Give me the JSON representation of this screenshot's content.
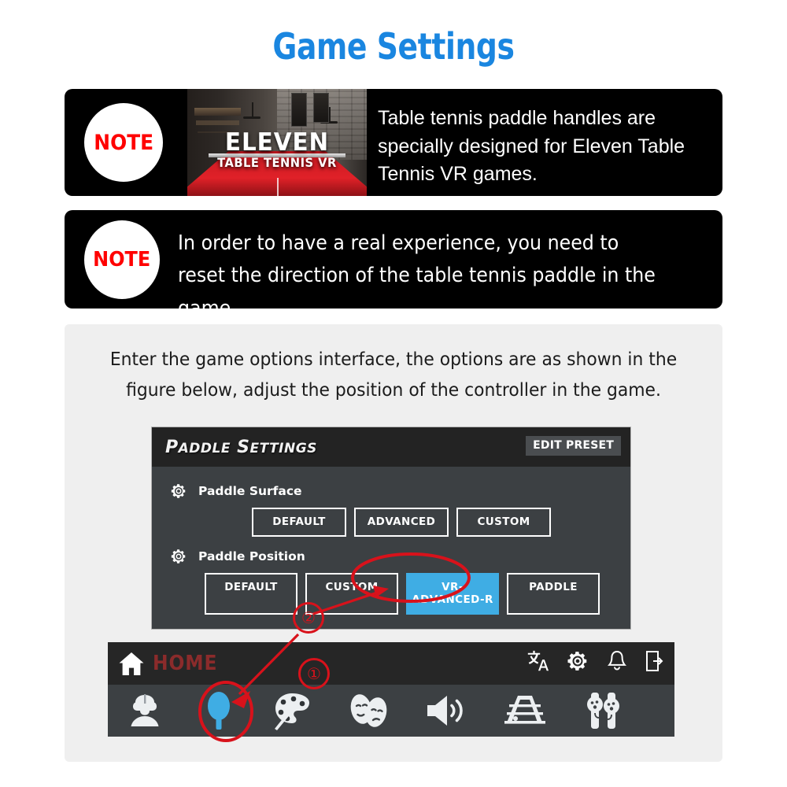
{
  "page": {
    "title": "Game Settings",
    "title_color": "#1a86e0",
    "background": "#ffffff"
  },
  "notes": [
    {
      "badge": "NOTE",
      "badge_color": "#ff0000",
      "text": "Table tennis paddle handles are specially designed for Eleven Table Tennis VR games.",
      "thumbnail": {
        "logo_line1": "ELEVEN",
        "logo_line2": "TABLE TENNIS VR",
        "alt": "eleven-table-tennis-vr-game-screenshot"
      }
    },
    {
      "badge": "NOTE",
      "badge_color": "#ff0000",
      "text": "In order to have a real experience, you need to reset the direction of the table tennis paddle in the game."
    }
  ],
  "instruction": {
    "text": "Enter the game options interface, the options are as shown in the figure below, adjust the position of the controller in the game."
  },
  "settings_panel": {
    "title_first": "P",
    "title_first_rest": "ADDLE",
    "title_second": "S",
    "title_second_rest": "ETTINGS",
    "edit_preset_label": "EDIT PRESET",
    "groups": [
      {
        "icon": "gear-icon",
        "label": "Paddle Surface",
        "options": [
          {
            "label": "DEFAULT",
            "selected": false
          },
          {
            "label": "ADVANCED",
            "selected": false
          },
          {
            "label": "CUSTOM",
            "selected": false
          }
        ]
      },
      {
        "icon": "gear-icon",
        "label": "Paddle Position",
        "options": [
          {
            "label": "DEFAULT",
            "selected": false
          },
          {
            "label": "CUSTOM",
            "selected": false
          },
          {
            "label": "VR-ADVANCED-R",
            "selected": true
          },
          {
            "label": "PADDLE",
            "selected": false
          }
        ]
      }
    ],
    "selected_color": "#3fade4"
  },
  "home_bar": {
    "home_label": "HOME",
    "home_label_color": "#8b2b2b",
    "top_icons": [
      {
        "name": "translate-icon"
      },
      {
        "name": "gear-icon"
      },
      {
        "name": "bell-icon"
      },
      {
        "name": "exit-icon"
      }
    ],
    "bottom_icons": [
      {
        "name": "avatar-vr-headset-icon",
        "highlighted": false
      },
      {
        "name": "paddle-icon",
        "highlighted": true
      },
      {
        "name": "palette-icon",
        "highlighted": false
      },
      {
        "name": "masks-icon",
        "highlighted": false
      },
      {
        "name": "speaker-icon",
        "highlighted": false
      },
      {
        "name": "table-icon",
        "highlighted": false
      },
      {
        "name": "controllers-icon",
        "highlighted": false
      }
    ]
  },
  "annotations": {
    "color": "#d8121b",
    "marker_one": "①",
    "marker_two": "②"
  }
}
